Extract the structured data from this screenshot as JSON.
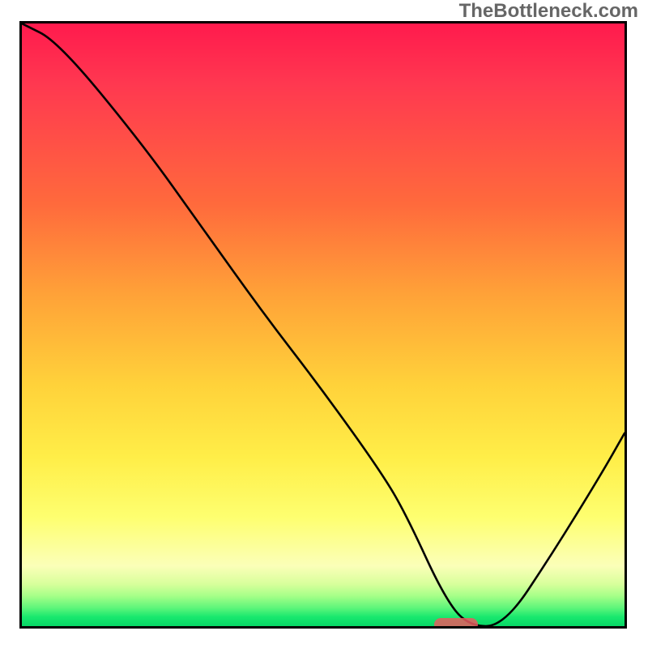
{
  "watermark": "TheBottleneck.com",
  "chart_data": {
    "type": "line",
    "title": "",
    "xlabel": "",
    "ylabel": "",
    "xlim": [
      0,
      100
    ],
    "ylim": [
      0,
      100
    ],
    "grid": false,
    "legend": false,
    "background": {
      "style": "vertical-gradient",
      "stops": [
        {
          "pos": 0.0,
          "color": "#ff1a4d"
        },
        {
          "pos": 0.3,
          "color": "#ff6a3c"
        },
        {
          "pos": 0.6,
          "color": "#ffd23a"
        },
        {
          "pos": 0.82,
          "color": "#feff70"
        },
        {
          "pos": 0.93,
          "color": "#d8ff9c"
        },
        {
          "pos": 1.0,
          "color": "#08d766"
        }
      ]
    },
    "series": [
      {
        "name": "bottleneck-curve",
        "x": [
          0,
          6,
          20,
          30,
          40,
          50,
          60,
          64,
          70,
          74,
          80,
          88,
          96,
          100
        ],
        "y": [
          100,
          97,
          80,
          66,
          52,
          39,
          25,
          18,
          5,
          0,
          0,
          12,
          25,
          32
        ]
      }
    ],
    "marker": {
      "name": "optimal-region",
      "x": 72,
      "y": 0,
      "color": "#e85a5f",
      "shape": "pill"
    }
  }
}
